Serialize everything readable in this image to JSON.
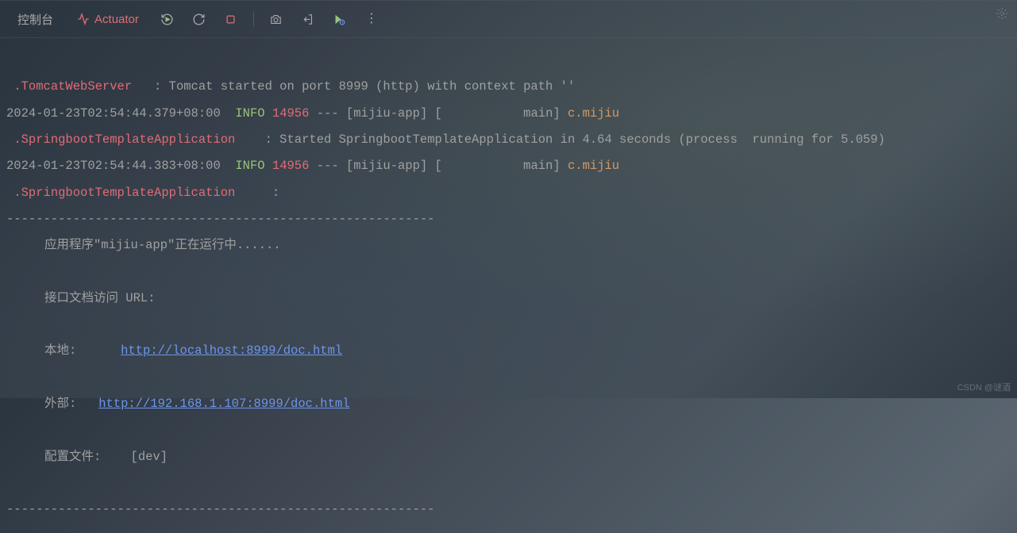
{
  "toolbar": {
    "console_tab": "控制台",
    "actuator_label": "Actuator"
  },
  "log": {
    "line1_class": ".TomcatWebServer",
    "line1_msg": ": Tomcat started on port 8999 (http) with context path ''",
    "ts1": "2024-01-23T02:54:44.379+08:00",
    "level": "INFO",
    "pid": "14956",
    "thread": "--- [mijiu-app] [           main] ",
    "logger1": "c.mijiu",
    "class2": ".SpringbootTemplateApplication",
    "msg2": ": Started SpringbootTemplateApplication in 4.64 seconds (process  running for 5.059)",
    "ts2": "2024-01-23T02:54:44.383+08:00",
    "logger2": "c.mijiu",
    "class3": ".SpringbootTemplateApplication",
    "colon3": ":",
    "dashes": "----------------------------------------------------------",
    "app_running": "应用程序\"mijiu-app\"正在运行中......",
    "api_doc_label": "接口文档访问 URL:",
    "local_label": "本地:",
    "local_url": "http://localhost:8999/doc.html",
    "external_label": "外部:",
    "external_url": "http://192.168.1.107:8999/doc.html",
    "profile_label": "配置文件:",
    "profile_value": "[dev]"
  },
  "watermark": "CSDN @谜酒"
}
